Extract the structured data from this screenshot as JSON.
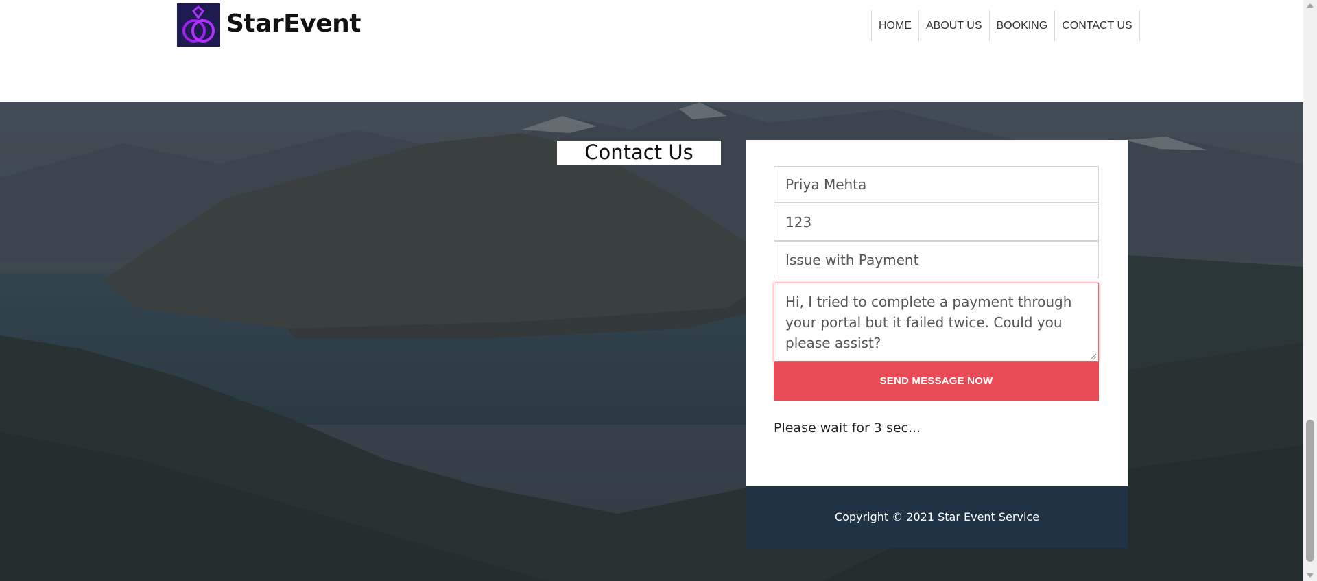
{
  "brand": {
    "name": "StarEvent",
    "logo_icon": "rings-icon"
  },
  "nav": {
    "items": [
      {
        "label": "HOME"
      },
      {
        "label": "ABOUT US"
      },
      {
        "label": "BOOKING"
      },
      {
        "label": "CONTACT US"
      }
    ]
  },
  "contact": {
    "heading": "Contact Us",
    "form": {
      "name_value": "Priya Mehta",
      "phone_value": "123",
      "subject_value": "Issue with Payment",
      "message_value": "Hi, I tried to complete a payment through your portal but it failed twice. Could you please assist?",
      "send_label": "SEND MESSAGE NOW",
      "status": "Please wait for 3 sec..."
    }
  },
  "footer": {
    "copyright": "Copyright © 2021 Star Event Service"
  },
  "colors": {
    "accent": "#e84b55",
    "footer_bg": "#1f3344",
    "logo_bg": "#1d1b4f",
    "logo_ring": "#a020f0"
  }
}
